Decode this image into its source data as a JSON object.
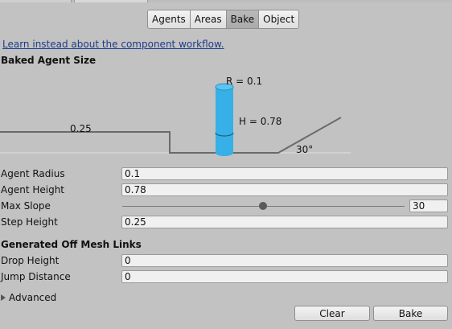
{
  "tabs": [
    {
      "label": "Agents"
    },
    {
      "label": "Areas"
    },
    {
      "label": "Bake",
      "active": true
    },
    {
      "label": "Object"
    }
  ],
  "link_text": "Learn instead about the component workflow.",
  "baked_agent_size": {
    "title": "Baked Agent Size",
    "diagram": {
      "radius_label": "R = 0.1",
      "height_label": "H = 0.78",
      "step_label": "0.25",
      "slope_label": "30°",
      "agent_color": "#36b0e6"
    }
  },
  "fields": {
    "agent_radius": {
      "label": "Agent Radius",
      "value": "0.1"
    },
    "agent_height": {
      "label": "Agent Height",
      "value": "0.78"
    },
    "max_slope": {
      "label": "Max Slope",
      "value": "30",
      "slider_fraction": 0.5
    },
    "step_height": {
      "label": "Step Height",
      "value": "0.25"
    }
  },
  "off_mesh_links": {
    "title": "Generated Off Mesh Links",
    "drop_height": {
      "label": "Drop Height",
      "value": "0"
    },
    "jump_distance": {
      "label": "Jump Distance",
      "value": "0"
    }
  },
  "advanced_label": "Advanced",
  "buttons": {
    "clear": "Clear",
    "bake": "Bake"
  }
}
